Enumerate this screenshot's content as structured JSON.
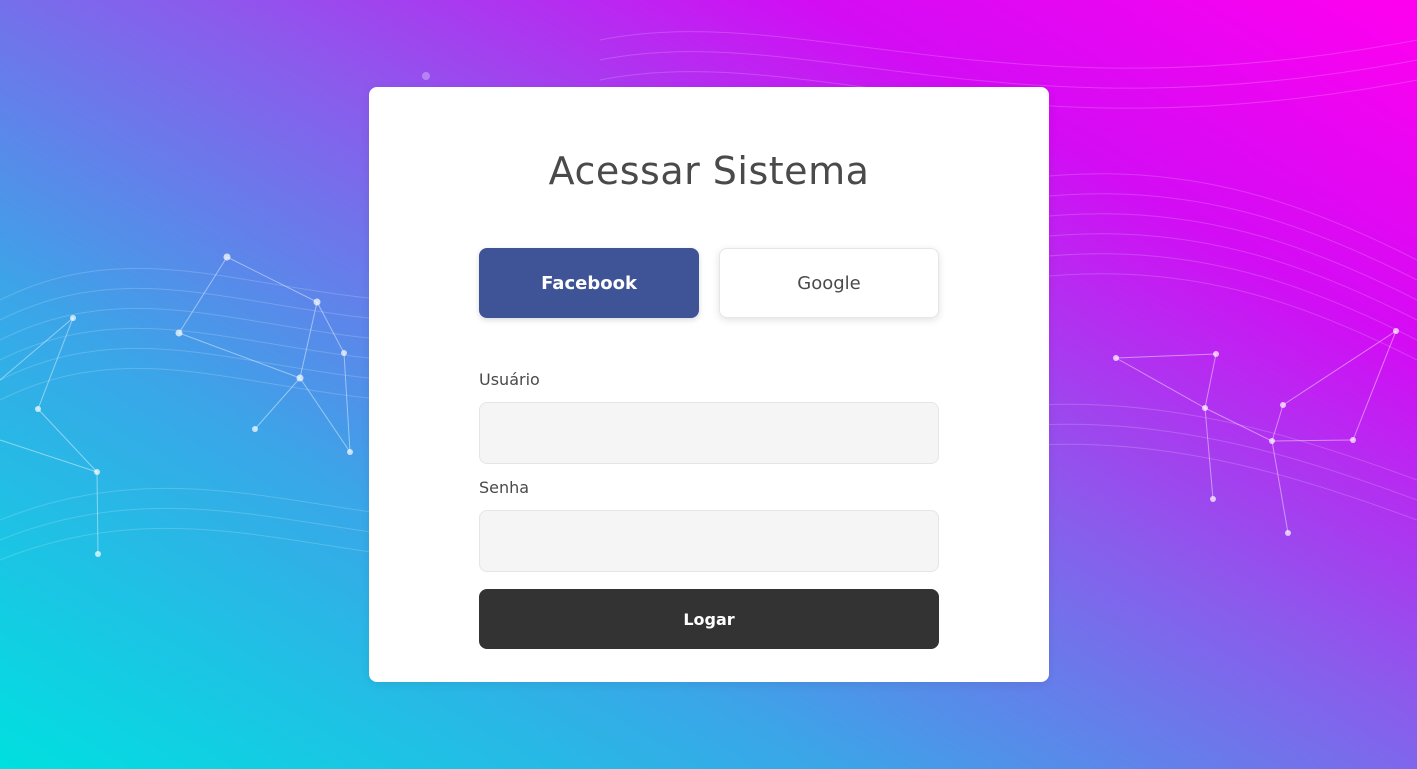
{
  "login": {
    "title": "Acessar Sistema",
    "facebook_label": "Facebook",
    "google_label": "Google",
    "username_label": "Usuário",
    "username_value": "",
    "password_label": "Senha",
    "password_value": "",
    "submit_label": "Logar"
  },
  "colors": {
    "facebook": "#3f5497",
    "submit": "#333333",
    "input_bg": "#f5f5f5",
    "gradient_start": "#00e0e0",
    "gradient_end": "#ff00f0"
  }
}
